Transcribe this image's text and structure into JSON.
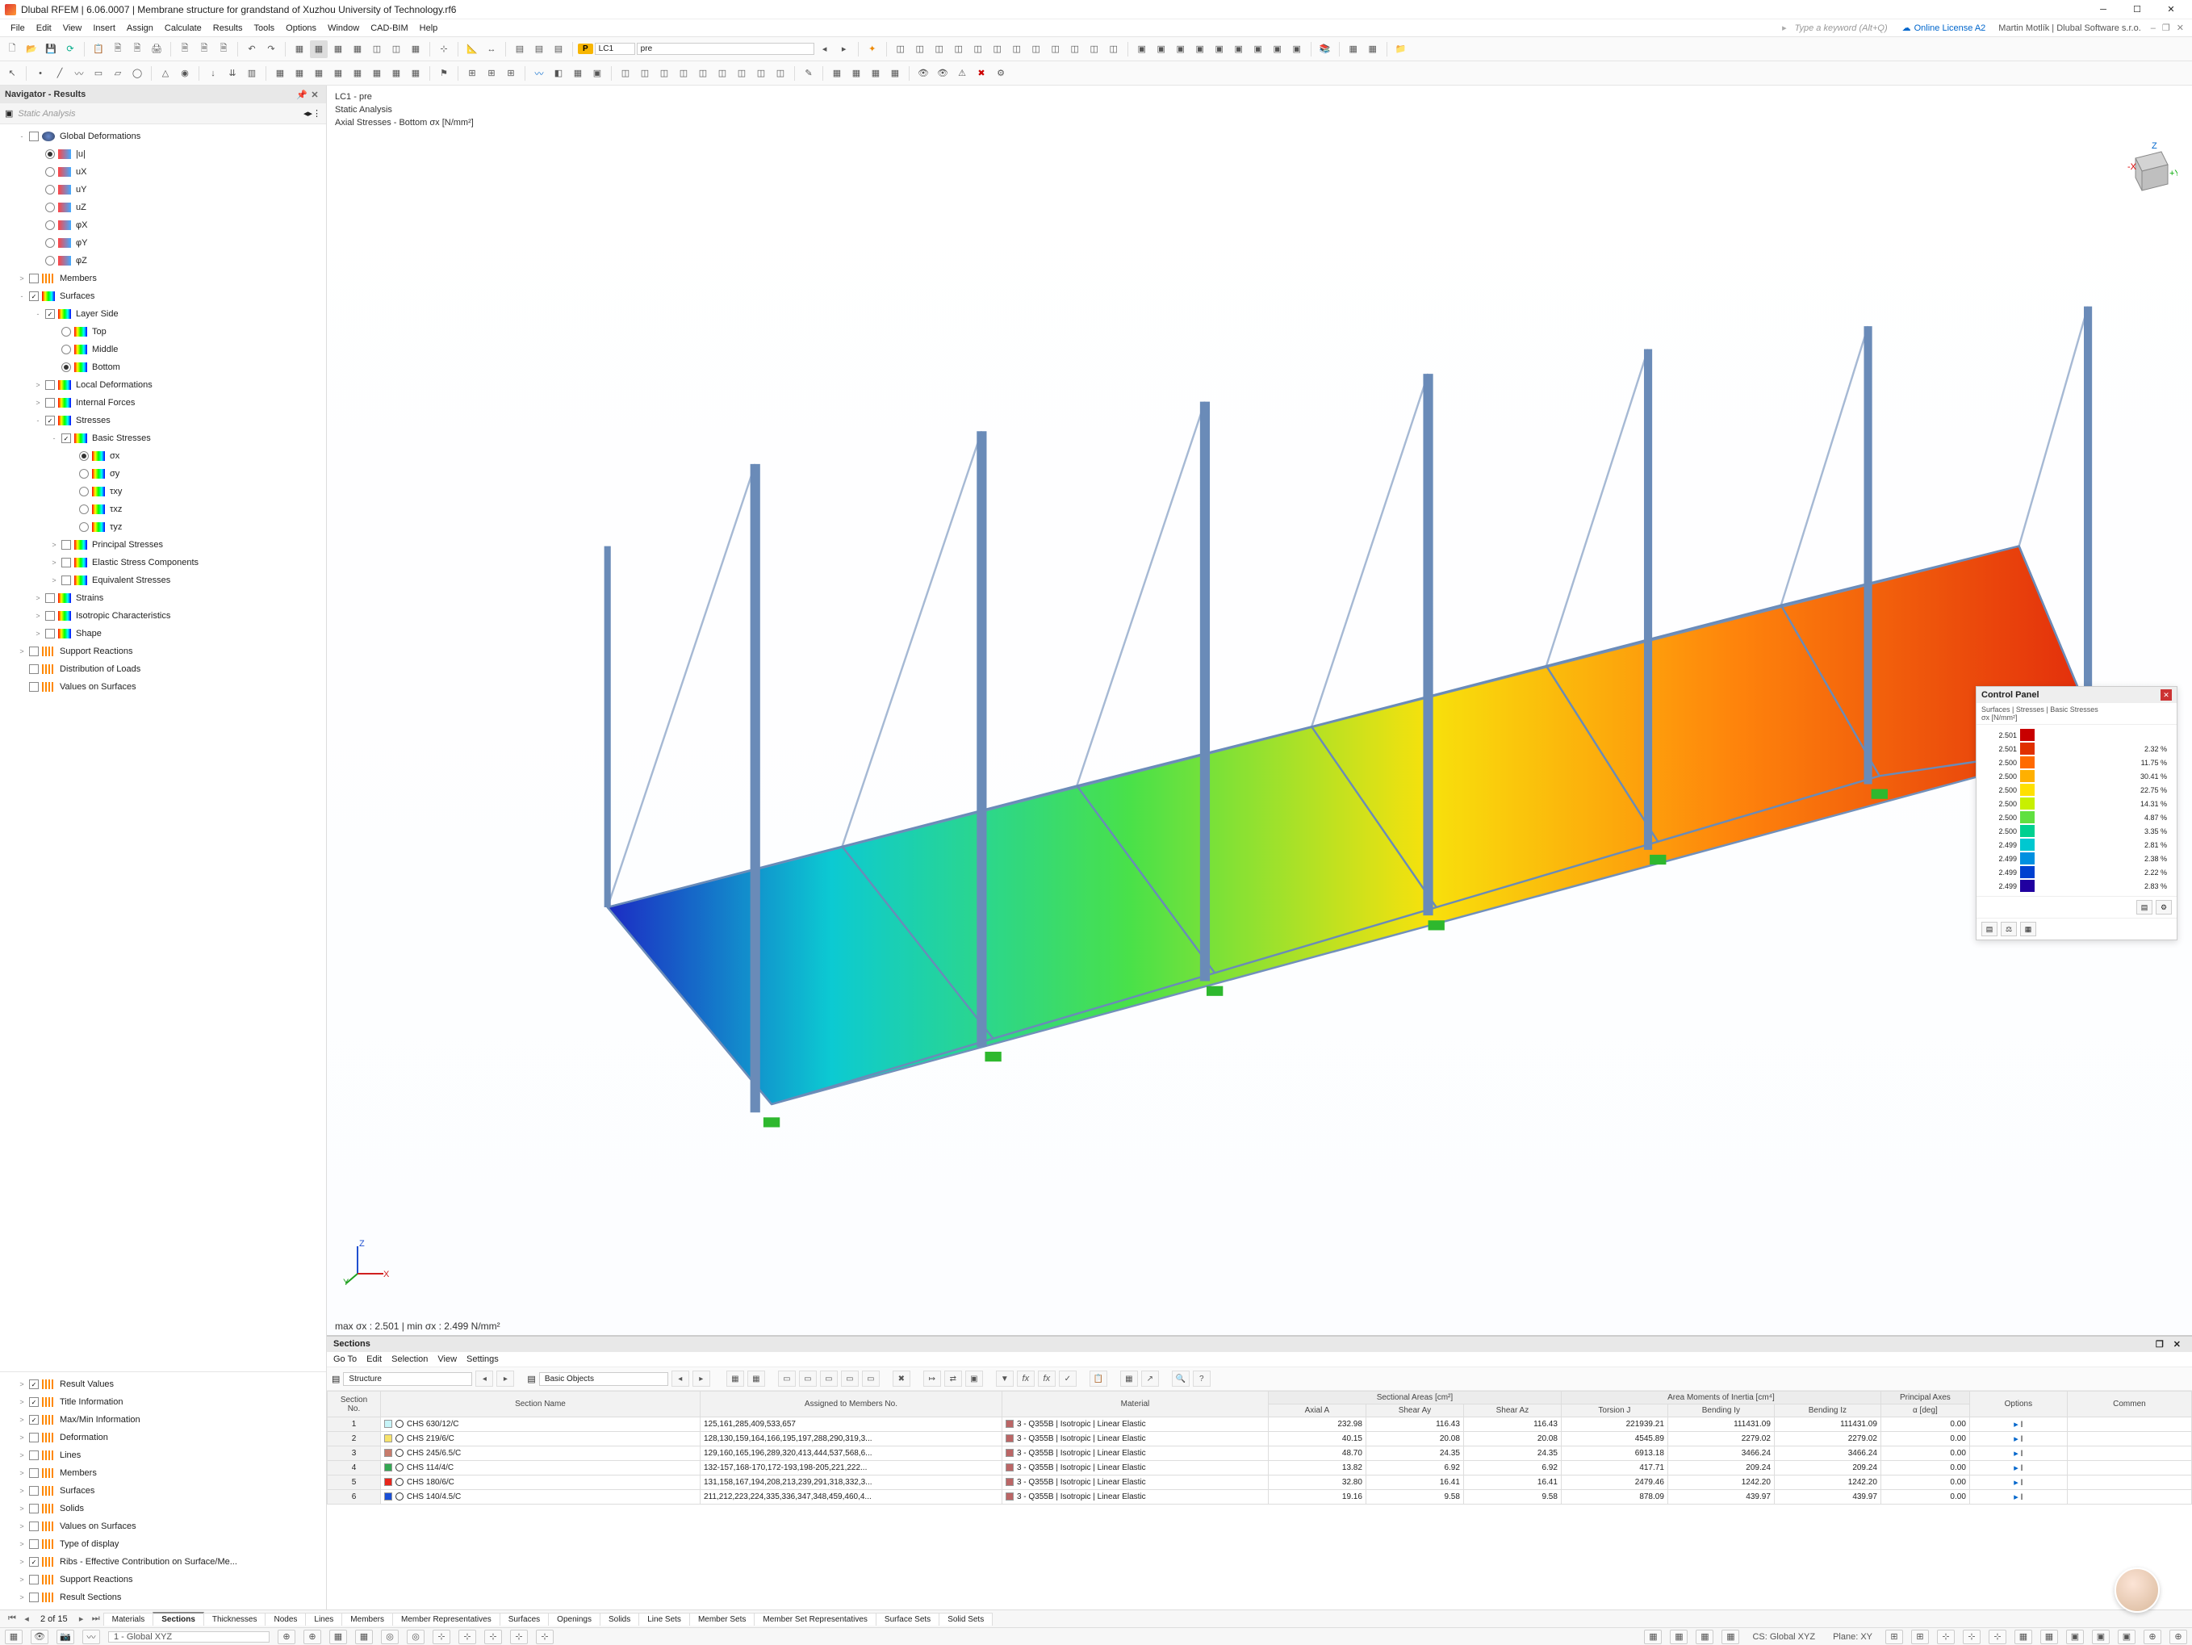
{
  "app": {
    "title": "Dlubal RFEM | 6.06.0007 | Membrane structure for grandstand of Xuzhou University of Technology.rf6",
    "search_hint": "Type a keyword (Alt+Q)",
    "license": "Online License A2",
    "user": "Martin Motlík | Dlubal Software s.r.o."
  },
  "menus": [
    "File",
    "Edit",
    "View",
    "Insert",
    "Assign",
    "Calculate",
    "Results",
    "Tools",
    "Options",
    "Window",
    "CAD-BIM",
    "Help"
  ],
  "lc": {
    "badge": "P",
    "code": "LC1",
    "desc": "pre"
  },
  "navigator": {
    "title": "Navigator - Results",
    "filter": "Static Analysis",
    "top_tree": [
      {
        "lvl": 1,
        "exp": "-",
        "chk": false,
        "ico": "globe",
        "label": "Global Deformations"
      },
      {
        "lvl": 2,
        "radio": true,
        "sel": true,
        "ico": "rect",
        "label": "|u|"
      },
      {
        "lvl": 2,
        "radio": true,
        "sel": false,
        "ico": "rect",
        "label": "uX"
      },
      {
        "lvl": 2,
        "radio": true,
        "sel": false,
        "ico": "rect",
        "label": "uY"
      },
      {
        "lvl": 2,
        "radio": true,
        "sel": false,
        "ico": "rect",
        "label": "uZ"
      },
      {
        "lvl": 2,
        "radio": true,
        "sel": false,
        "ico": "rect",
        "label": "φX"
      },
      {
        "lvl": 2,
        "radio": true,
        "sel": false,
        "ico": "rect",
        "label": "φY"
      },
      {
        "lvl": 2,
        "radio": true,
        "sel": false,
        "ico": "rect",
        "label": "φZ"
      },
      {
        "lvl": 1,
        "exp": ">",
        "chk": false,
        "ico": "lines",
        "label": "Members"
      },
      {
        "lvl": 1,
        "exp": "-",
        "chk": true,
        "ico": "grad",
        "label": "Surfaces"
      },
      {
        "lvl": 2,
        "exp": "-",
        "chk": true,
        "ico": "grad",
        "label": "Layer Side"
      },
      {
        "lvl": 3,
        "radio": true,
        "sel": false,
        "ico": "grad",
        "label": "Top"
      },
      {
        "lvl": 3,
        "radio": true,
        "sel": false,
        "ico": "grad",
        "label": "Middle"
      },
      {
        "lvl": 3,
        "radio": true,
        "sel": true,
        "ico": "grad",
        "label": "Bottom"
      },
      {
        "lvl": 2,
        "exp": ">",
        "chk": false,
        "ico": "grad",
        "label": "Local Deformations"
      },
      {
        "lvl": 2,
        "exp": ">",
        "chk": false,
        "ico": "grad",
        "label": "Internal Forces"
      },
      {
        "lvl": 2,
        "exp": "-",
        "chk": true,
        "ico": "grad",
        "label": "Stresses"
      },
      {
        "lvl": 3,
        "exp": "-",
        "chk": true,
        "ico": "grad",
        "label": "Basic Stresses"
      },
      {
        "lvl": 4,
        "radio": true,
        "sel": true,
        "ico": "grad",
        "label": "σx"
      },
      {
        "lvl": 4,
        "radio": true,
        "sel": false,
        "ico": "grad",
        "label": "σy"
      },
      {
        "lvl": 4,
        "radio": true,
        "sel": false,
        "ico": "grad",
        "label": "τxy"
      },
      {
        "lvl": 4,
        "radio": true,
        "sel": false,
        "ico": "grad",
        "label": "τxz"
      },
      {
        "lvl": 4,
        "radio": true,
        "sel": false,
        "ico": "grad",
        "label": "τyz"
      },
      {
        "lvl": 3,
        "exp": ">",
        "chk": false,
        "ico": "grad",
        "label": "Principal Stresses"
      },
      {
        "lvl": 3,
        "exp": ">",
        "chk": false,
        "ico": "grad",
        "label": "Elastic Stress Components"
      },
      {
        "lvl": 3,
        "exp": ">",
        "chk": false,
        "ico": "grad",
        "label": "Equivalent Stresses"
      },
      {
        "lvl": 2,
        "exp": ">",
        "chk": false,
        "ico": "grad",
        "label": "Strains"
      },
      {
        "lvl": 2,
        "exp": ">",
        "chk": false,
        "ico": "grad",
        "label": "Isotropic Characteristics"
      },
      {
        "lvl": 2,
        "exp": ">",
        "chk": false,
        "ico": "grad",
        "label": "Shape"
      },
      {
        "lvl": 1,
        "exp": ">",
        "chk": false,
        "ico": "lines",
        "label": "Support Reactions"
      },
      {
        "lvl": 1,
        "exp": "",
        "chk": false,
        "ico": "lines",
        "label": "Distribution of Loads"
      },
      {
        "lvl": 1,
        "exp": "",
        "chk": false,
        "ico": "lines",
        "label": "Values on Surfaces"
      }
    ],
    "bottom_tree": [
      {
        "chk": true,
        "label": "Result Values"
      },
      {
        "chk": true,
        "label": "Title Information"
      },
      {
        "chk": true,
        "label": "Max/Min Information"
      },
      {
        "chk": false,
        "label": "Deformation"
      },
      {
        "chk": false,
        "label": "Lines"
      },
      {
        "chk": false,
        "label": "Members"
      },
      {
        "chk": false,
        "label": "Surfaces"
      },
      {
        "chk": false,
        "label": "Solids"
      },
      {
        "chk": false,
        "label": "Values on Surfaces"
      },
      {
        "chk": false,
        "label": "Type of display"
      },
      {
        "chk": true,
        "label": "Ribs - Effective Contribution on Surface/Me..."
      },
      {
        "chk": false,
        "label": "Support Reactions"
      },
      {
        "chk": false,
        "label": "Result Sections"
      }
    ]
  },
  "viewport": {
    "line1": "LC1 - pre",
    "line2": "Static Analysis",
    "line3": "Axial Stresses - Bottom σx [N/mm²]",
    "minmax": "max σx : 2.501 | min σx : 2.499 N/mm²"
  },
  "control_panel": {
    "title": "Control Panel",
    "sub": "Surfaces | Stresses | Basic Stresses\nσx [N/mm²]",
    "rows": [
      {
        "v": "2.501",
        "c": "#c80000",
        "p": ""
      },
      {
        "v": "2.501",
        "c": "#e03000",
        "p": "2.32 %"
      },
      {
        "v": "2.500",
        "c": "#ff6a00",
        "p": "11.75 %"
      },
      {
        "v": "2.500",
        "c": "#ffb000",
        "p": "30.41 %"
      },
      {
        "v": "2.500",
        "c": "#ffe000",
        "p": "22.75 %"
      },
      {
        "v": "2.500",
        "c": "#c8f000",
        "p": "14.31 %"
      },
      {
        "v": "2.500",
        "c": "#60e040",
        "p": "4.87 %"
      },
      {
        "v": "2.500",
        "c": "#00d090",
        "p": "3.35 %"
      },
      {
        "v": "2.499",
        "c": "#00c8d0",
        "p": "2.81 %"
      },
      {
        "v": "2.499",
        "c": "#0090e0",
        "p": "2.38 %"
      },
      {
        "v": "2.499",
        "c": "#0040d0",
        "p": "2.22 %"
      },
      {
        "v": "2.499",
        "c": "#2000a0",
        "p": "2.83 %"
      }
    ]
  },
  "sections": {
    "title": "Sections",
    "menu": [
      "Go To",
      "Edit",
      "Selection",
      "View",
      "Settings"
    ],
    "structure": "Structure",
    "basic": "Basic Objects",
    "group_headers": {
      "section_no": "Section\nNo.",
      "section_name": "Section Name",
      "assigned": "Assigned to Members No.",
      "material": "Material",
      "areas": "Sectional Areas [cm²]",
      "inertia": "Area Moments of Inertia [cm⁴]",
      "paxes": "Principal Axes",
      "options": "Options",
      "comment": "Commen"
    },
    "sub_headers": [
      "Axial A",
      "Shear Ay",
      "Shear Az",
      "Torsion J",
      "Bending Iy",
      "Bending Iz",
      "α [deg]"
    ],
    "rows": [
      {
        "n": "1",
        "c": "#c7f4f8",
        "name": "CHS 630/12/C",
        "assigned": "125,161,285,409,533,657",
        "mat": "3 - Q355B | Isotropic | Linear Elastic",
        "a": "232.98",
        "ay": "116.43",
        "az": "116.43",
        "j": "221939.21",
        "iy": "111431.09",
        "iz": "111431.09",
        "alpha": "0.00"
      },
      {
        "n": "2",
        "c": "#f7e36b",
        "name": "CHS 219/6/C",
        "assigned": "128,130,159,164,166,195,197,288,290,319,3...",
        "mat": "3 - Q355B | Isotropic | Linear Elastic",
        "a": "40.15",
        "ay": "20.08",
        "az": "20.08",
        "j": "4545.89",
        "iy": "2279.02",
        "iz": "2279.02",
        "alpha": "0.00"
      },
      {
        "n": "3",
        "c": "#c77b6b",
        "name": "CHS 245/6.5/C",
        "assigned": "129,160,165,196,289,320,413,444,537,568,6...",
        "mat": "3 - Q355B | Isotropic | Linear Elastic",
        "a": "48.70",
        "ay": "24.35",
        "az": "24.35",
        "j": "6913.18",
        "iy": "3466.24",
        "iz": "3466.24",
        "alpha": "0.00"
      },
      {
        "n": "4",
        "c": "#34a853",
        "name": "CHS 114/4/C",
        "assigned": "132-157,168-170,172-193,198-205,221,222...",
        "mat": "3 - Q355B | Isotropic | Linear Elastic",
        "a": "13.82",
        "ay": "6.92",
        "az": "6.92",
        "j": "417.71",
        "iy": "209.24",
        "iz": "209.24",
        "alpha": "0.00"
      },
      {
        "n": "5",
        "c": "#e8261c",
        "name": "CHS 180/6/C",
        "assigned": "131,158,167,194,208,213,239,291,318,332,3...",
        "mat": "3 - Q355B | Isotropic | Linear Elastic",
        "a": "32.80",
        "ay": "16.41",
        "az": "16.41",
        "j": "2479.46",
        "iy": "1242.20",
        "iz": "1242.20",
        "alpha": "0.00"
      },
      {
        "n": "6",
        "c": "#1a4fd6",
        "name": "CHS 140/4.5/C",
        "assigned": "211,212,223,224,335,336,347,348,459,460,4...",
        "mat": "3 - Q355B | Isotropic | Linear Elastic",
        "a": "19.16",
        "ay": "9.58",
        "az": "9.58",
        "j": "878.09",
        "iy": "439.97",
        "iz": "439.97",
        "alpha": "0.00"
      }
    ]
  },
  "tabs": {
    "page": "2 of 15",
    "items": [
      "Materials",
      "Sections",
      "Thicknesses",
      "Nodes",
      "Lines",
      "Members",
      "Member Representatives",
      "Surfaces",
      "Openings",
      "Solids",
      "Line Sets",
      "Member Sets",
      "Member Set Representatives",
      "Surface Sets",
      "Solid Sets"
    ],
    "active": "Sections"
  },
  "status": {
    "cs_combo": "1 - Global XYZ",
    "cs": "CS: Global XYZ",
    "plane": "Plane: XY"
  }
}
